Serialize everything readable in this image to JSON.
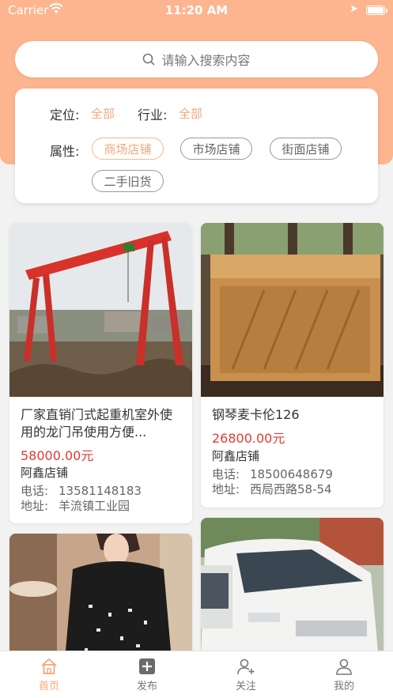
{
  "status_bar": {
    "carrier": "Carrier",
    "time": "11:20 AM"
  },
  "search": {
    "placeholder": "请输入搜索内容"
  },
  "filters": {
    "location_label": "定位:",
    "location_value": "全部",
    "industry_label": "行业:",
    "industry_value": "全部",
    "attribute_label": "属性:",
    "attributes": [
      "商场店铺",
      "市场店铺",
      "街面店铺",
      "二手旧货"
    ],
    "selected_attribute": "商场店铺"
  },
  "listings": [
    {
      "title": "厂家直销门式起重机室外使用的龙门吊使用方便...",
      "price": "58000.00元",
      "shop": "阿鑫店铺",
      "phone_label": "电话:",
      "phone": "13581148183",
      "address_label": "地址:",
      "address": "羊流镇工业园"
    },
    {
      "title": "钢琴麦卡伦126",
      "price": "26800.00元",
      "shop": "阿鑫店铺",
      "phone_label": "电话:",
      "phone": "18500648679",
      "address_label": "地址:",
      "address": "西局西路58-54"
    }
  ],
  "tabbar": [
    {
      "label": "首页",
      "icon": "home-icon",
      "active": true
    },
    {
      "label": "发布",
      "icon": "plus-square-icon",
      "active": false
    },
    {
      "label": "关注",
      "icon": "add-user-icon",
      "active": false
    },
    {
      "label": "我的",
      "icon": "user-icon",
      "active": false
    }
  ],
  "colors": {
    "accent": "#fdb58f",
    "accent_text": "#f5a77a",
    "price": "#e53935"
  }
}
